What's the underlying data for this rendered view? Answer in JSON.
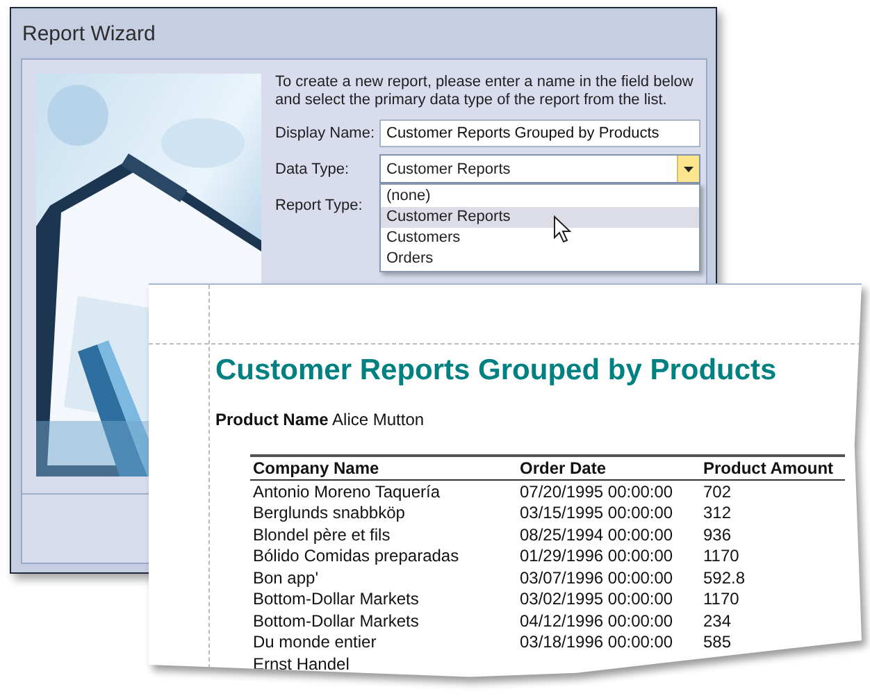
{
  "window": {
    "title": "Report Wizard"
  },
  "intro": "To create a new report, please enter a name in the field below and select the primary data type of the report from the list.",
  "fields": [
    {
      "kind": "text",
      "label": "Display Name:",
      "value": "Customer Reports Grouped by Products"
    },
    {
      "kind": "combo",
      "label": "Data Type:",
      "value": "Customer Reports",
      "expanded": true,
      "options": [
        {
          "label": "(none)",
          "selected": false
        },
        {
          "label": "Customer Reports",
          "selected": true
        },
        {
          "label": "Customers",
          "selected": false
        },
        {
          "label": "Orders",
          "selected": false
        }
      ]
    },
    {
      "kind": "label",
      "label": "Report Type:"
    }
  ],
  "report": {
    "title": "Customer Reports Grouped by Products",
    "group_label": "Product Name",
    "group_value": "Alice Mutton",
    "columns": [
      "Company Name",
      "Order Date",
      "Product Amount"
    ],
    "rows": [
      [
        "Antonio Moreno Taquería",
        "07/20/1995 00:00:00",
        "702"
      ],
      [
        "Berglunds snabbköp",
        "03/15/1995 00:00:00",
        "312"
      ],
      [
        "Blondel père et fils",
        "08/25/1994 00:00:00",
        "936"
      ],
      [
        "Bólido Comidas preparadas",
        "01/29/1996 00:00:00",
        "1170"
      ],
      [
        "Bon app'",
        "03/07/1996 00:00:00",
        "592.8"
      ],
      [
        "Bottom-Dollar Markets",
        "03/02/1995 00:00:00",
        "1170"
      ],
      [
        "Bottom-Dollar Markets",
        "04/12/1996 00:00:00",
        "234"
      ],
      [
        "Du monde entier",
        "03/18/1996 00:00:00",
        "585"
      ],
      [
        "Ernst Handel"
      ]
    ]
  }
}
